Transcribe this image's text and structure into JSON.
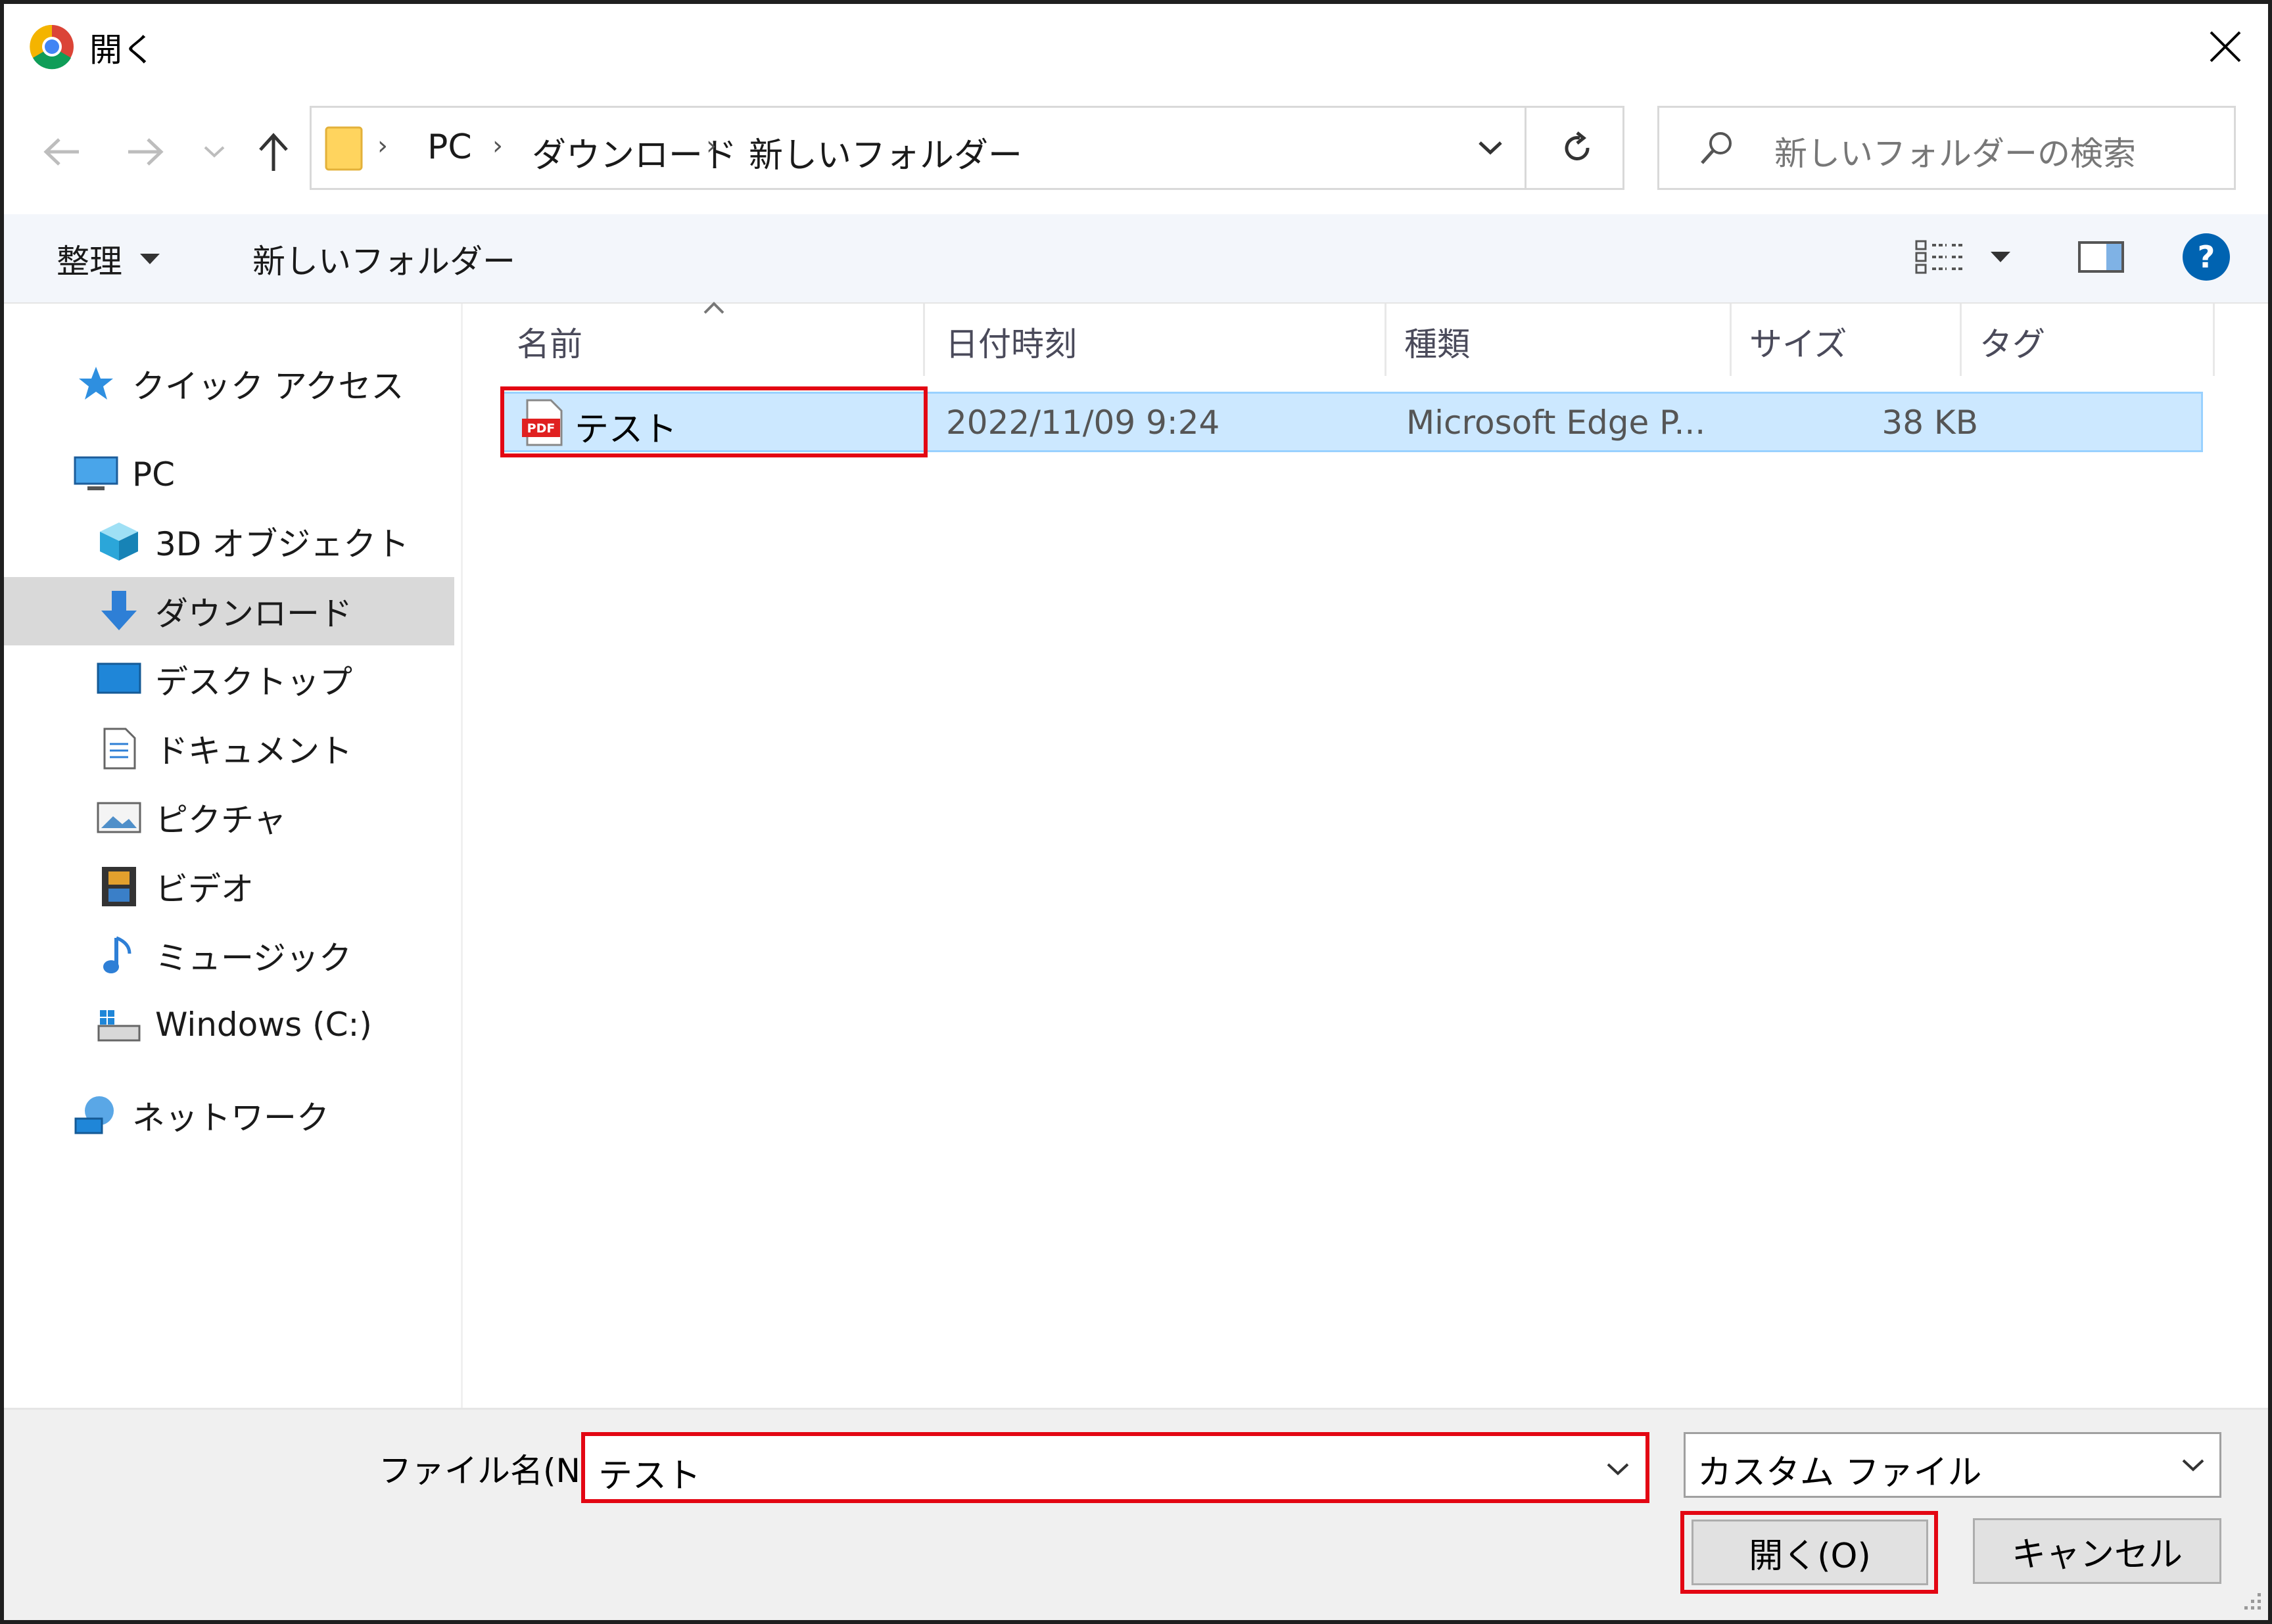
{
  "window": {
    "title": "開く"
  },
  "address": {
    "breadcrumbs": [
      "PC",
      "ダウンロード",
      "新しいフォルダー"
    ]
  },
  "search": {
    "placeholder": "新しいフォルダーの検索"
  },
  "toolbar": {
    "organize_label": "整理",
    "new_folder_label": "新しいフォルダー"
  },
  "sidebar": {
    "items": [
      {
        "label": "クイック アクセス",
        "icon": "star-icon"
      },
      {
        "label": "PC",
        "icon": "pc-icon"
      },
      {
        "label": "3D オブジェクト",
        "icon": "cube-icon"
      },
      {
        "label": "ダウンロード",
        "icon": "download-arrow-icon",
        "selected": true
      },
      {
        "label": "デスクトップ",
        "icon": "desktop-icon"
      },
      {
        "label": "ドキュメント",
        "icon": "document-icon"
      },
      {
        "label": "ピクチャ",
        "icon": "picture-icon"
      },
      {
        "label": "ビデオ",
        "icon": "film-icon"
      },
      {
        "label": "ミュージック",
        "icon": "music-note-icon"
      },
      {
        "label": "Windows (C:)",
        "icon": "drive-icon"
      },
      {
        "label": "ネットワーク",
        "icon": "network-icon"
      }
    ]
  },
  "table": {
    "columns": [
      "名前",
      "日付時刻",
      "種類",
      "サイズ",
      "タグ"
    ],
    "rows": [
      {
        "name": "テスト",
        "date": "2022/11/09 9:24",
        "type": "Microsoft Edge P...",
        "size": "38 KB",
        "tags": "",
        "icon": "pdf-icon"
      }
    ]
  },
  "footer": {
    "filename_label": "ファイル名(N):",
    "filename_value": "テスト",
    "filter_value": "カスタム ファイル",
    "open_label": "開く(O)",
    "cancel_label": "キャンセル"
  },
  "colors": {
    "highlight_border": "#e30613",
    "selection_fill": "#cce8ff",
    "help_blue": "#0063b1"
  }
}
